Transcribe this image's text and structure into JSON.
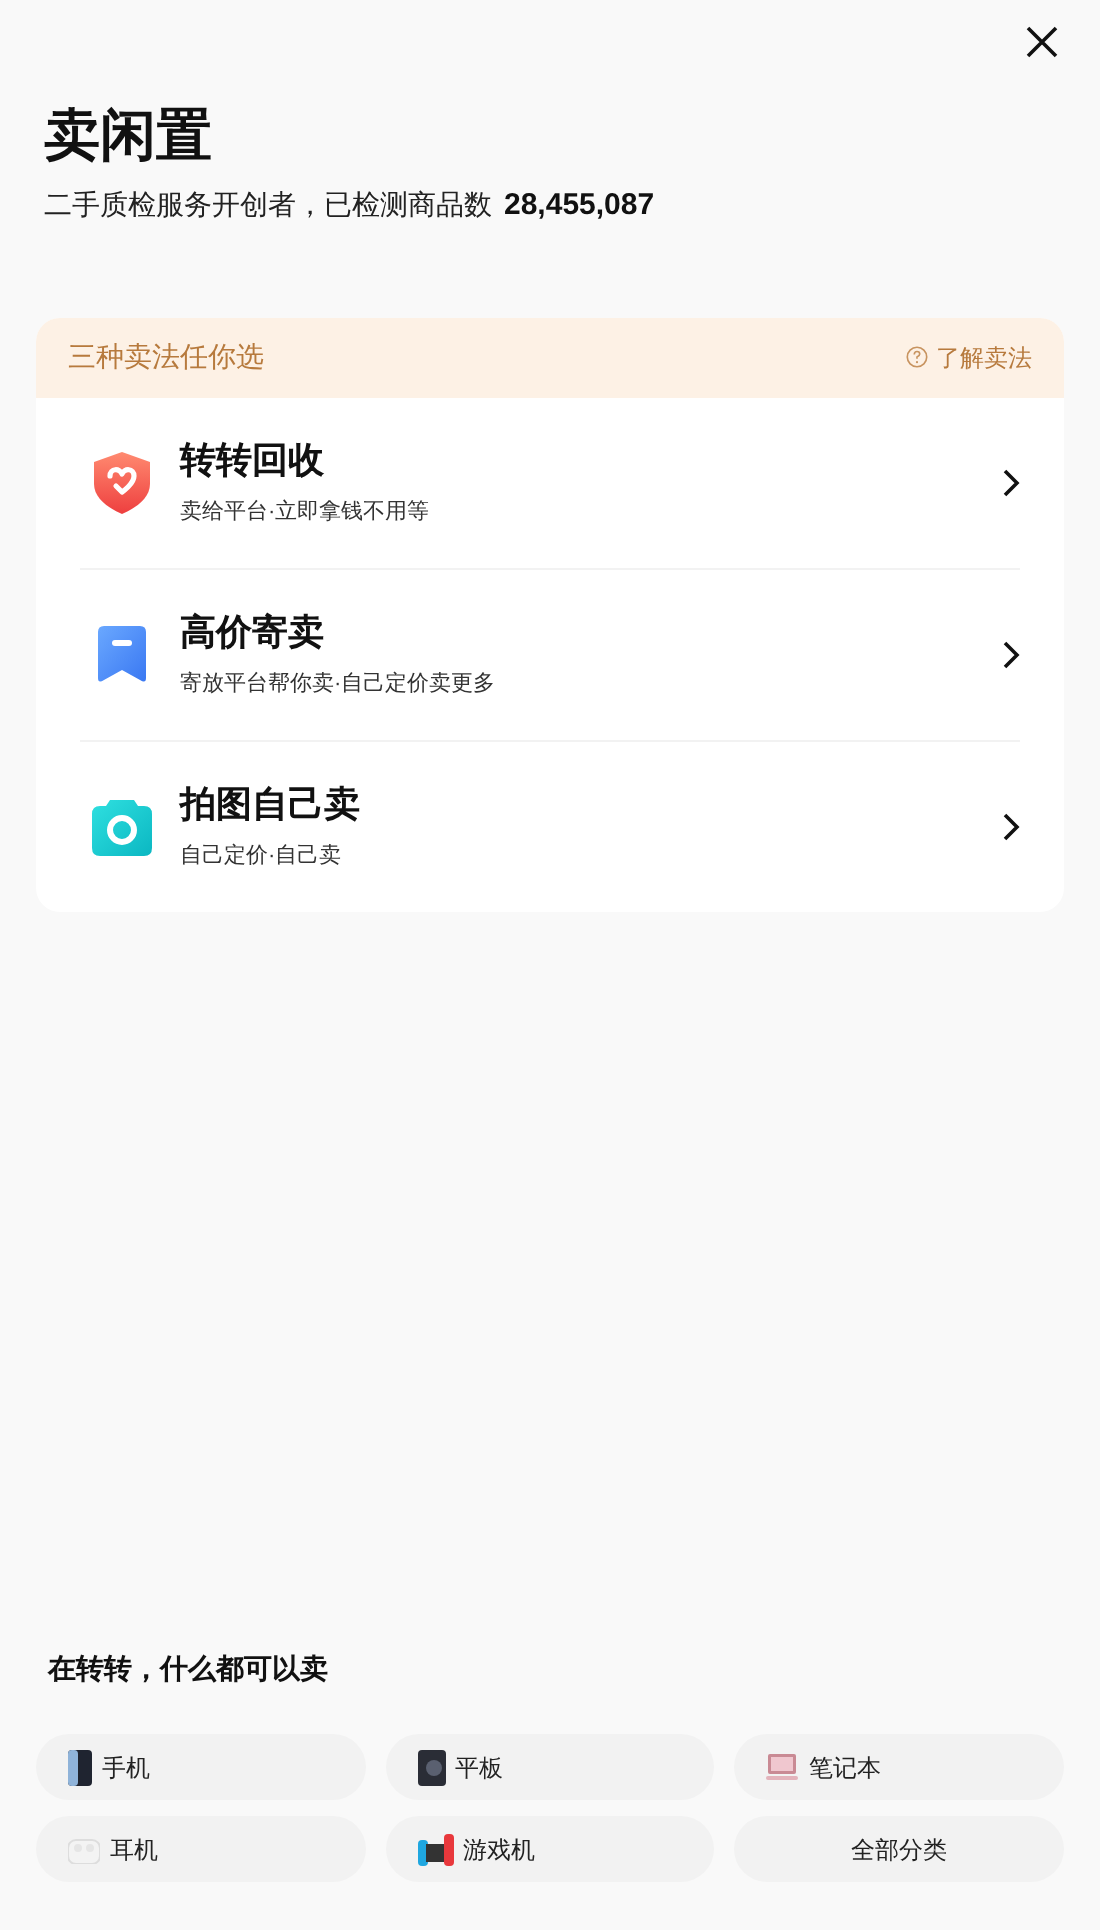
{
  "header": {
    "title": "卖闲置",
    "subtitle": "二手质检服务开创者，已检测商品数",
    "count": "28,455,087"
  },
  "methods_card": {
    "heading": "三种卖法任你选",
    "help_link": "了解卖法",
    "methods": [
      {
        "title": "转转回收",
        "description": "卖给平台·立即拿钱不用等"
      },
      {
        "title": "高价寄卖",
        "description": "寄放平台帮你卖·自己定价卖更多"
      },
      {
        "title": "拍图自己卖",
        "description": "自己定价·自己卖"
      }
    ]
  },
  "categories": {
    "heading": "在转转，什么都可以卖",
    "items": [
      {
        "kind": "item",
        "label": "手机"
      },
      {
        "kind": "item",
        "label": "平板"
      },
      {
        "kind": "item",
        "label": "笔记本"
      },
      {
        "kind": "item",
        "label": "耳机"
      },
      {
        "kind": "item",
        "label": "游戏机"
      },
      {
        "kind": "all",
        "label": "全部分类"
      }
    ]
  }
}
